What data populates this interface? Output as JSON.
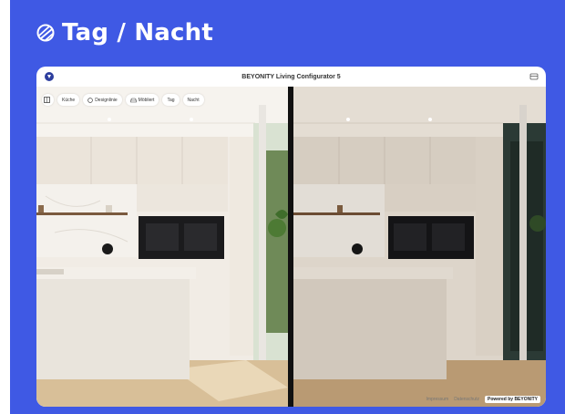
{
  "header": {
    "title": "Tag / Nacht",
    "icon": "day-night-icon"
  },
  "window": {
    "title": "BEYONITY Living Configurator 5",
    "logo": "beyonity-logo-icon",
    "menu_icon": "menu-icon"
  },
  "toolbar": {
    "items": [
      {
        "icon": "floorplan-icon",
        "label": ""
      },
      {
        "label": "Küche"
      },
      {
        "icon": "design-icon",
        "label": "Designlinie"
      },
      {
        "icon": "sofa-icon",
        "label": "Möbliert"
      },
      {
        "label": "Tag"
      },
      {
        "label": "Nacht"
      }
    ]
  },
  "footer": {
    "link1": "Impressum",
    "link2": "Datenschutz",
    "powered": "Powered by  BEYONITY"
  },
  "colors": {
    "background": "#3f59e4",
    "day_wall": "#f1ece5",
    "night_wall": "#ddd5ca"
  }
}
